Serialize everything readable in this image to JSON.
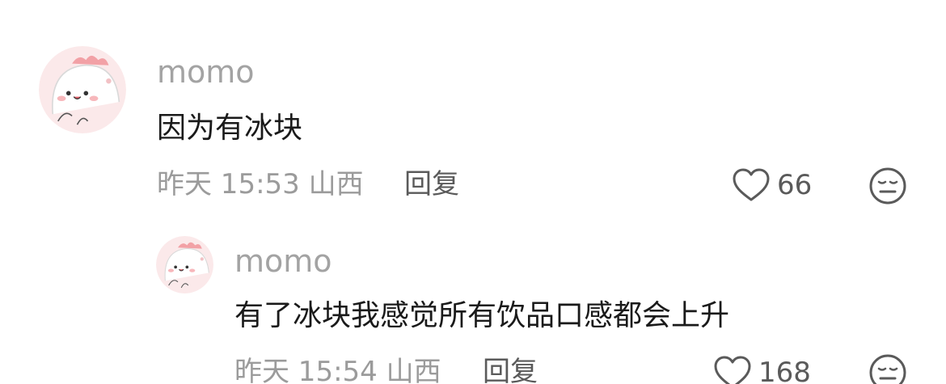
{
  "comments": [
    {
      "username": "momo",
      "text": "因为有冰块",
      "time": "昨天 15:53 山西",
      "reply_label": "回复",
      "likes": "66",
      "avatar_icon": "cartoon-dino-avatar",
      "like_icon": "heart-outline-icon",
      "dislike_icon": "neutral-face-icon"
    },
    {
      "username": "momo",
      "text": "有了冰块我感觉所有饮品口感都会上升",
      "time": "昨天 15:54 山西",
      "reply_label": "回复",
      "likes": "168",
      "avatar_icon": "cartoon-dino-avatar",
      "like_icon": "heart-outline-icon",
      "dislike_icon": "neutral-face-icon"
    }
  ],
  "colors": {
    "username": "#a3a3a3",
    "content": "#1a1a1a",
    "meta": "#9b9b9b",
    "action": "#5a5a5a",
    "avatar_bg": "#fbe9ea",
    "avatar_accent": "#f2a1a6"
  }
}
